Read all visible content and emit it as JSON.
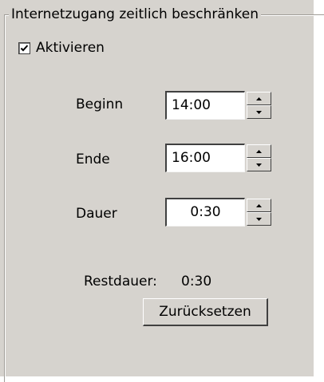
{
  "group": {
    "title": "Internetzugang zeitlich beschränken"
  },
  "activate": {
    "label": "Aktivieren",
    "checked": true
  },
  "fields": {
    "beginn": {
      "label": "Beginn",
      "value": "14:00"
    },
    "ende": {
      "label": "Ende",
      "value": "16:00"
    },
    "dauer": {
      "label": "Dauer",
      "value": "0:30"
    }
  },
  "status": {
    "restdauer_label": "Restdauer:",
    "restdauer_value": "0:30"
  },
  "actions": {
    "reset_label": "Zurücksetzen"
  },
  "colors": {
    "dialog_background": "#d6d3ce",
    "window_background": "#ffffff"
  }
}
